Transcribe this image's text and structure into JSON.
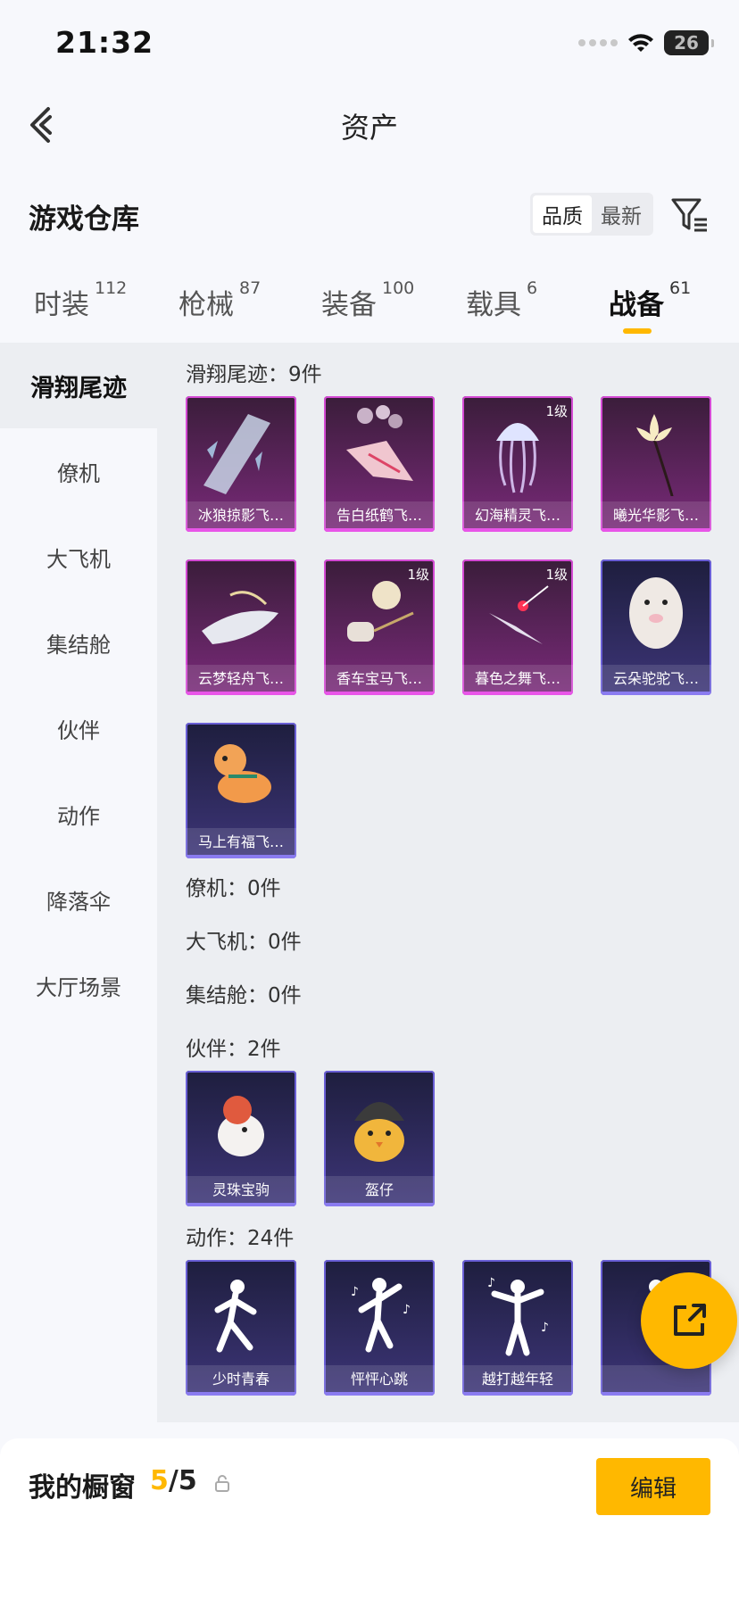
{
  "status_bar": {
    "time": "21:32",
    "battery": "26"
  },
  "nav": {
    "title": "资产",
    "back_icon": "chevron-left-icon"
  },
  "header": {
    "title": "游戏仓库",
    "sort_options": [
      "品质",
      "最新"
    ],
    "sort_active": "品质",
    "filter_icon": "filter-icon"
  },
  "tabs": [
    {
      "label": "时装",
      "count": "112"
    },
    {
      "label": "枪械",
      "count": "87"
    },
    {
      "label": "装备",
      "count": "100"
    },
    {
      "label": "载具",
      "count": "6"
    },
    {
      "label": "战备",
      "count": "61",
      "active": true
    }
  ],
  "sidebar": {
    "items": [
      "滑翔尾迹",
      "僚机",
      "大飞机",
      "集结舱",
      "伙伴",
      "动作",
      "降落伞",
      "大厅场景"
    ],
    "active": "滑翔尾迹"
  },
  "groups": [
    {
      "title": "滑翔尾迹：9件"
    },
    {
      "title": "僚机：0件"
    },
    {
      "title": "大飞机：0件"
    },
    {
      "title": "集结舱：0件"
    },
    {
      "title": "伙伴：2件"
    },
    {
      "title": "动作：24件"
    }
  ],
  "cards": {
    "glide": [
      {
        "name": "冰狼掠影飞…",
        "rarity": "purple",
        "level": ""
      },
      {
        "name": "告白纸鹤飞…",
        "rarity": "purple",
        "level": ""
      },
      {
        "name": "幻海精灵飞…",
        "rarity": "purple",
        "level": "1级"
      },
      {
        "name": "曦光华影飞…",
        "rarity": "purple",
        "level": ""
      },
      {
        "name": "云梦轻舟飞…",
        "rarity": "purple",
        "level": ""
      },
      {
        "name": "香车宝马飞…",
        "rarity": "purple",
        "level": "1级"
      },
      {
        "name": "暮色之舞飞…",
        "rarity": "purple",
        "level": "1级"
      },
      {
        "name": "云朵驼驼飞…",
        "rarity": "blue",
        "level": ""
      },
      {
        "name": "马上有福飞…",
        "rarity": "blue",
        "level": ""
      }
    ],
    "partner": [
      {
        "name": "灵珠宝驹",
        "rarity": "blue",
        "level": ""
      },
      {
        "name": "盔仔",
        "rarity": "blue",
        "level": ""
      }
    ],
    "emote": [
      {
        "name": "少时青春",
        "rarity": "blue",
        "level": ""
      },
      {
        "name": "怦怦心跳",
        "rarity": "blue",
        "level": ""
      },
      {
        "name": "越打越年轻",
        "rarity": "blue",
        "level": ""
      },
      {
        "name": "",
        "rarity": "blue",
        "level": ""
      }
    ]
  },
  "bottom_bar": {
    "label": "我的橱窗",
    "current": "5",
    "total": "/5",
    "lock_icon": "lock-icon",
    "edit_label": "编辑"
  },
  "fab": {
    "icon": "share-external-icon"
  },
  "colors": {
    "accent": "#ffb800",
    "purple_rarity": "#d44ad4",
    "blue_rarity": "#6a5fd6"
  }
}
